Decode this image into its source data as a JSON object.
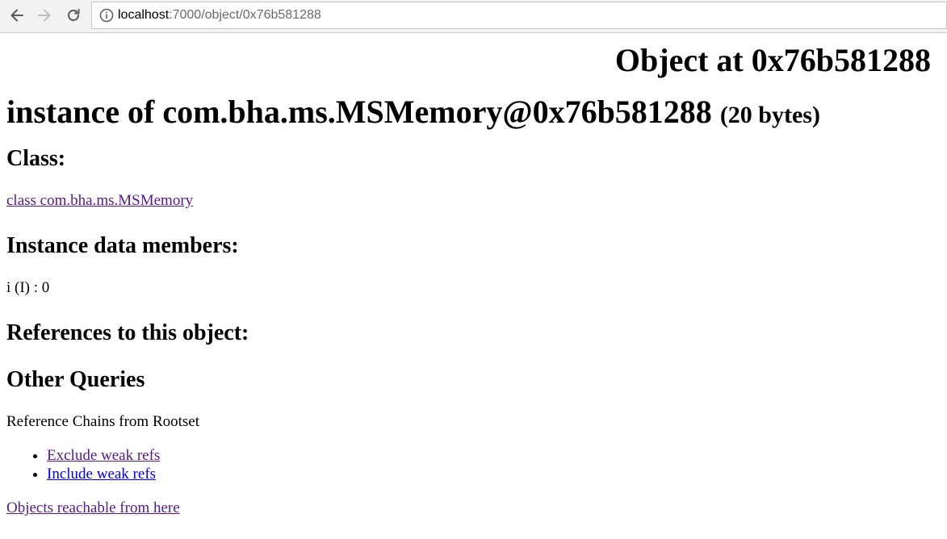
{
  "browser": {
    "url_host": "localhost",
    "url_rest": ":7000/object/0x76b581288",
    "icons": [
      "back-arrow-icon",
      "forward-arrow-icon",
      "reload-icon",
      "info-icon"
    ]
  },
  "page": {
    "title": "Object at 0x76b581288",
    "instance_prefix": "instance of com.bha.ms.MSMemory@0x76b581288",
    "instance_size": "(20 bytes)",
    "class_heading": "Class:",
    "class_link": "class com.bha.ms.MSMemory",
    "members_heading": "Instance data members:",
    "members": [
      "i (I) : 0"
    ],
    "references_heading": "References to this object:",
    "other_heading": "Other Queries",
    "chains_label": "Reference Chains from Rootset",
    "chain_links": [
      "Exclude weak refs",
      "Include weak refs"
    ],
    "reachable_link": "Objects reachable from here"
  }
}
